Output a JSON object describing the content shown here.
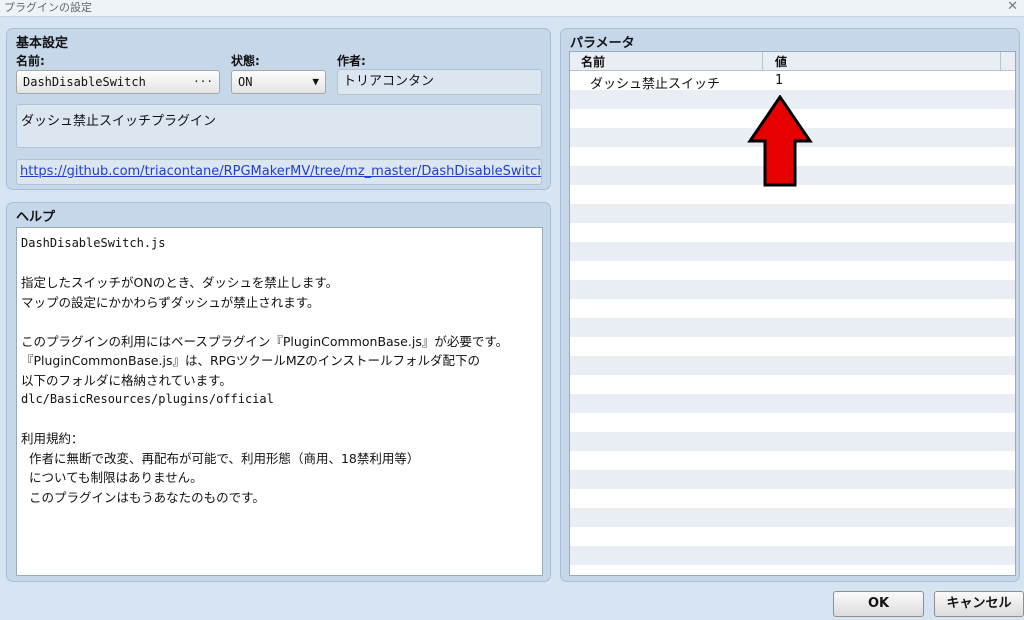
{
  "window": {
    "title": "プラグインの設定",
    "close_glyph": "✕"
  },
  "basic": {
    "title": "基本設定",
    "name_label": "名前:",
    "name_value": "DashDisableSwitch",
    "name_button": "···",
    "status_label": "状態:",
    "status_value": "ON",
    "status_arrow": "▼",
    "author_label": "作者:",
    "author_value": "トリアコンタン",
    "description": "ダッシュ禁止スイッチプラグイン",
    "url": "https://github.com/triacontane/RPGMakerMV/tree/mz_master/DashDisableSwitch…"
  },
  "help": {
    "title": "ヘルプ",
    "lines": [
      "DashDisableSwitch.js",
      "",
      "指定したスイッチがONのとき、ダッシュを禁止します。",
      "マップの設定にかかわらずダッシュが禁止されます。",
      "",
      "このプラグインの利用にはベースプラグイン『PluginCommonBase.js』が必要です。",
      "『PluginCommonBase.js』は、RPGツクールMZのインストールフォルダ配下の",
      "以下のフォルダに格納されています。",
      "dlc/BasicResources/plugins/official",
      "",
      "利用規約：",
      "  作者に無断で改変、再配布が可能で、利用形態（商用、18禁利用等）",
      "  についても制限はありません。",
      "  このプラグインはもうあなたのものです。"
    ]
  },
  "params": {
    "title": "パラメータ",
    "columns": [
      "名前",
      "値"
    ],
    "rows": [
      {
        "name": "ダッシュ禁止スイッチ",
        "value": "1"
      }
    ]
  },
  "buttons": {
    "ok": "OK",
    "cancel": "キャンセル"
  },
  "colors": {
    "panel": "#c6d7ea",
    "background": "#d6e4f2",
    "link": "#1f3fcc",
    "arrow": "#e60000"
  },
  "icons": {
    "close": "close-icon",
    "annotation": "red-up-arrow-icon"
  }
}
